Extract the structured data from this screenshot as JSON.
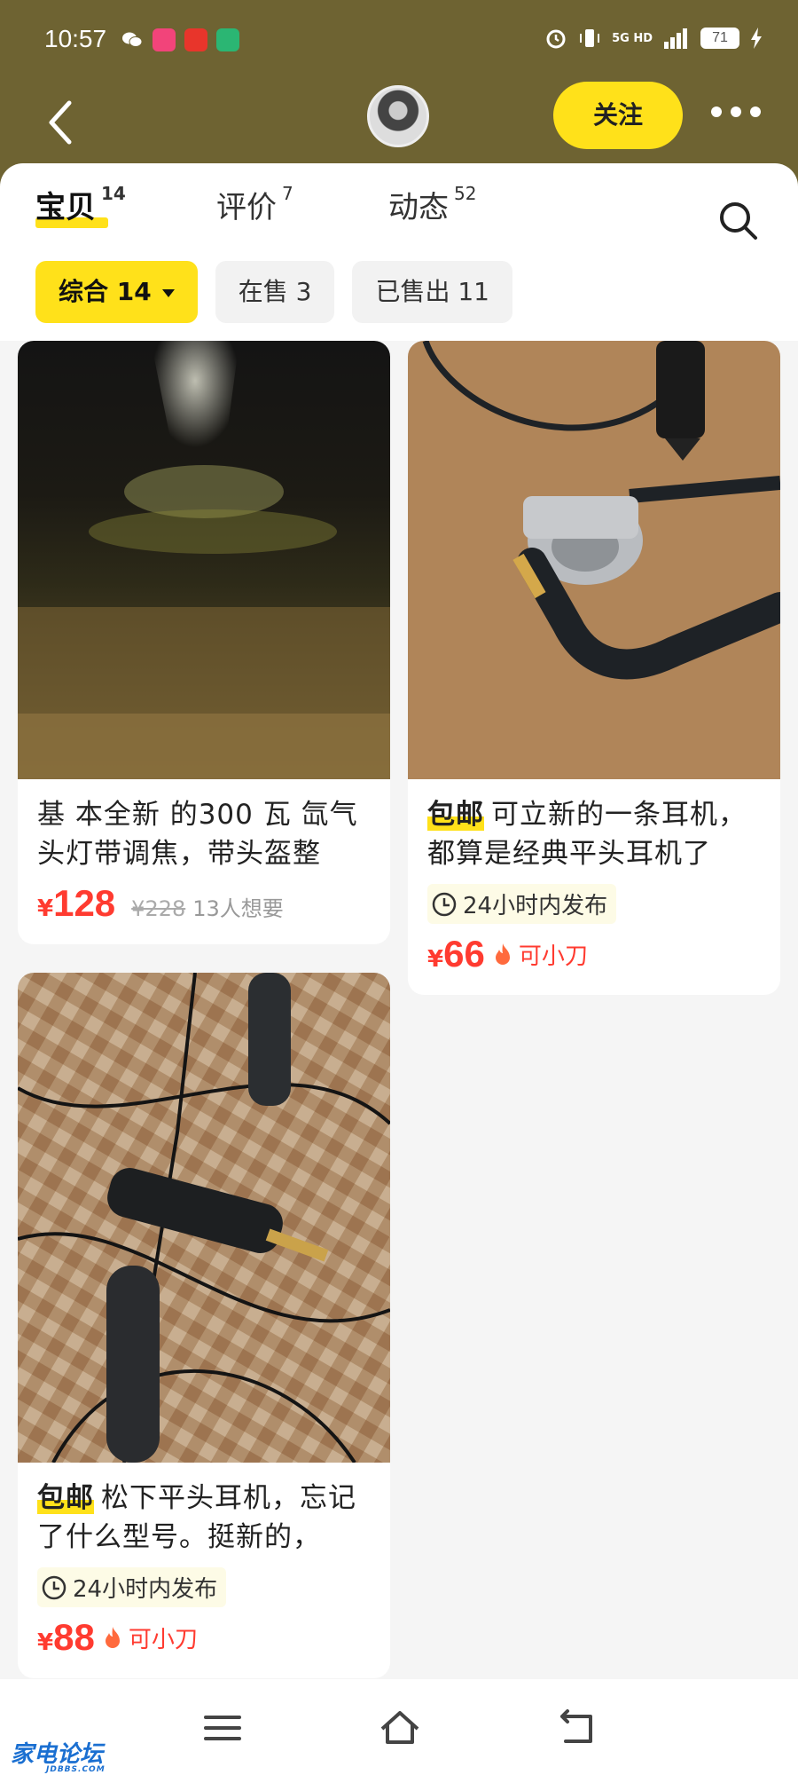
{
  "status_bar": {
    "time": "10:57",
    "network": "5G HD",
    "battery": "71"
  },
  "header": {
    "follow_label": "关注"
  },
  "tabs": [
    {
      "label": "宝贝",
      "count": "14"
    },
    {
      "label": "评价",
      "count": "7"
    },
    {
      "label": "动态",
      "count": "52"
    }
  ],
  "filters": [
    {
      "label": "综合 14"
    },
    {
      "label": "在售 3"
    },
    {
      "label": "已售出 11"
    }
  ],
  "items": [
    {
      "title": "基 本全新 的300 瓦 氙气头灯带调焦，带头盔整",
      "price_symbol": "¥",
      "price": "128",
      "original_price": "¥228",
      "wants": "13人想要"
    },
    {
      "shipping_tag": "包邮",
      "title": "可立新的一条耳机，都算是经典平头耳机了",
      "posted": "24小时内发布",
      "price_symbol": "¥",
      "price": "66",
      "bargain": "可小刀"
    },
    {
      "shipping_tag": "包邮",
      "title": "松下平头耳机，忘记了什么型号。挺新的，",
      "posted": "24小时内发布",
      "price_symbol": "¥",
      "price": "88",
      "bargain": "可小刀"
    }
  ],
  "watermark": {
    "name": "家电论坛",
    "domain": "JDBBS.COM"
  },
  "colors": {
    "header_bg": "#6e6332",
    "accent_yellow": "#ffe11a",
    "price_red": "#ff3b30"
  }
}
